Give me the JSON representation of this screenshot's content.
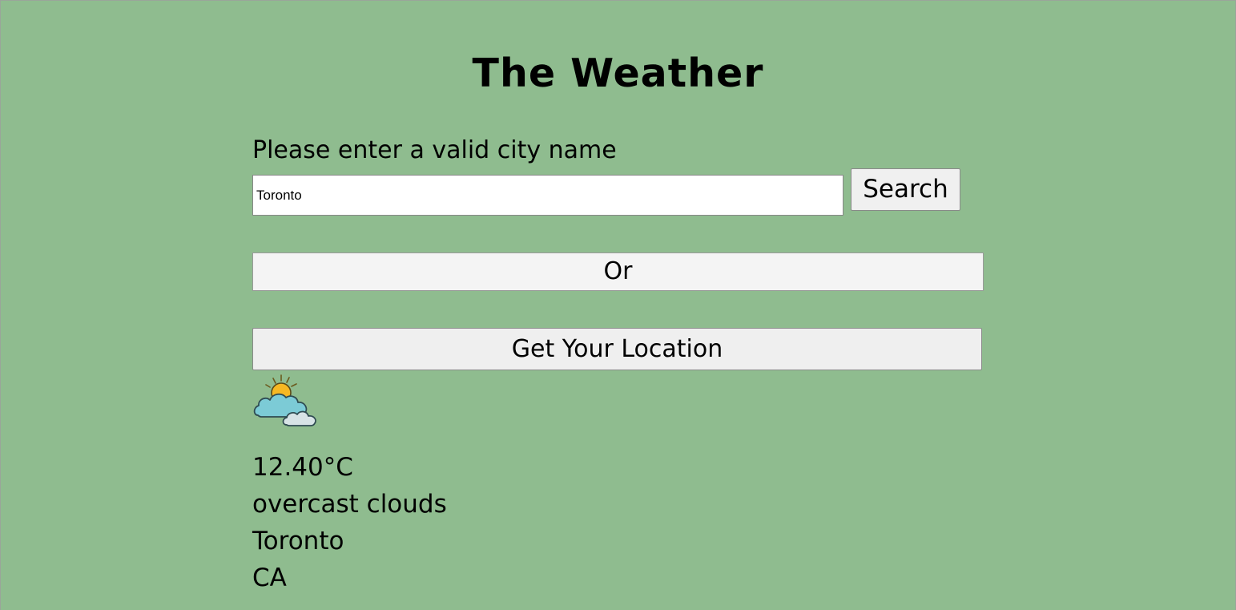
{
  "page": {
    "title": "The Weather",
    "background_color": "#8fbc8f"
  },
  "search": {
    "prompt": "Please enter a valid city name",
    "input_value": "Toronto",
    "button_label": "Search"
  },
  "divider": {
    "label": "Or"
  },
  "geolocation": {
    "button_label": "Get Your Location"
  },
  "weather": {
    "icon": "partly-cloudy-sun-icon",
    "temperature": "12.40°C",
    "description": "overcast clouds",
    "city": "Toronto",
    "country": "CA"
  }
}
